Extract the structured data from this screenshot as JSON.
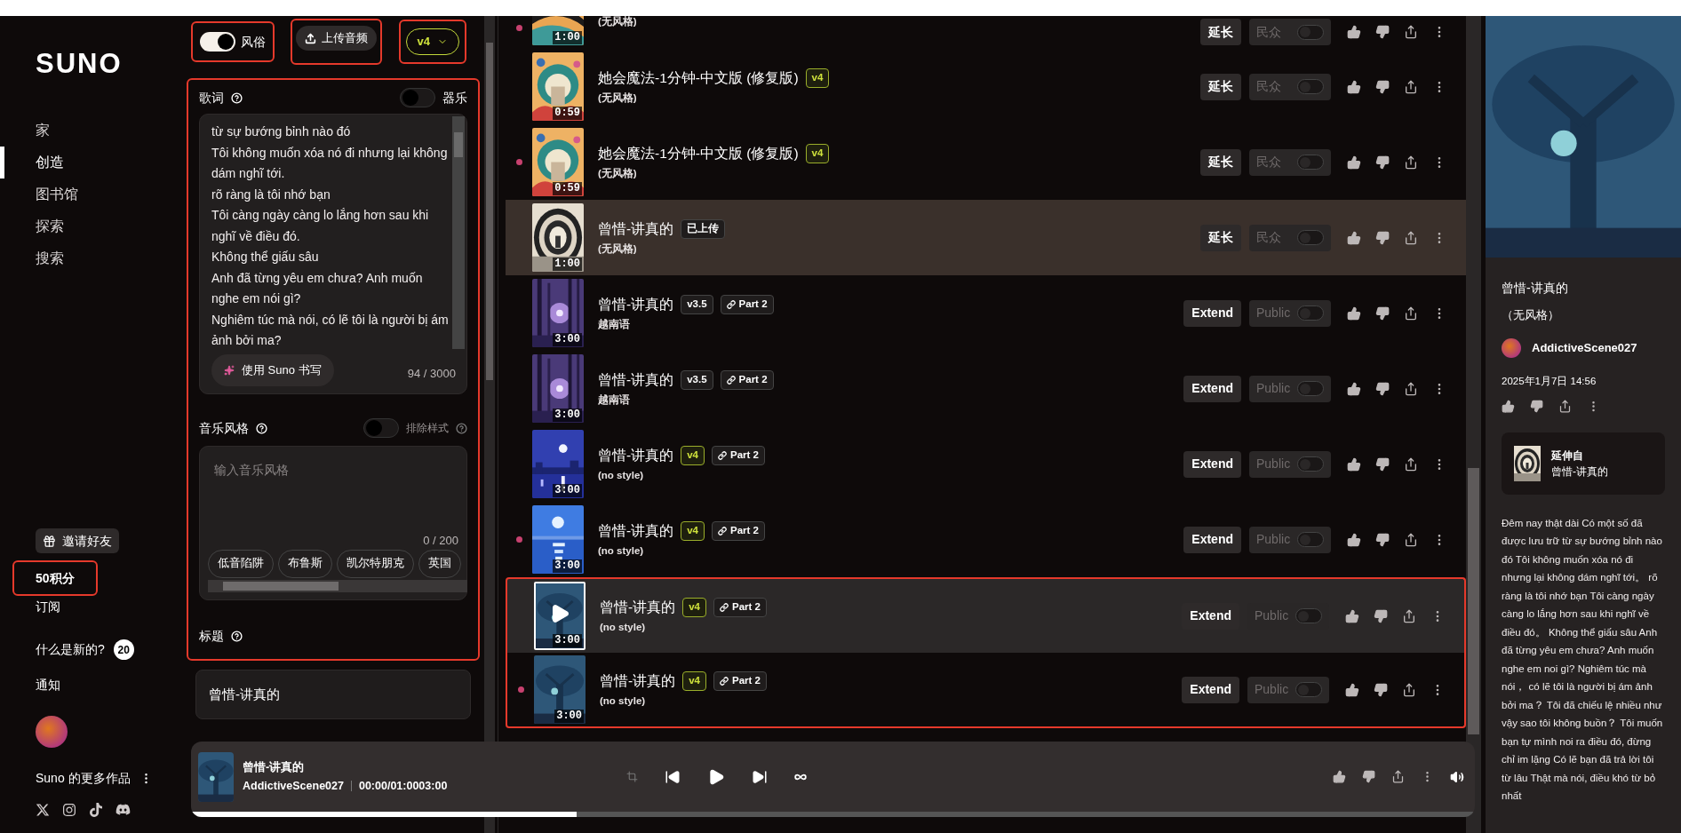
{
  "sidebar": {
    "logo": "SUNO",
    "nav": [
      {
        "label": "家",
        "selected": false
      },
      {
        "label": "创造",
        "selected": true
      },
      {
        "label": "图书馆",
        "selected": false
      },
      {
        "label": "探索",
        "selected": false
      },
      {
        "label": "搜索",
        "selected": false
      }
    ],
    "invite": "邀请好友",
    "credits": {
      "label": "50积分",
      "framed": true
    },
    "subscribe": "订阅",
    "whats_new": {
      "label": "什么是新的?",
      "count": "20"
    },
    "notifications": "通知",
    "more_from": "Suno 的更多作品"
  },
  "create": {
    "style_toggle": {
      "label": "风俗",
      "on": true,
      "framed": true
    },
    "upload": {
      "label": "上传音频",
      "framed": true
    },
    "version": {
      "label": "v4",
      "framed": true
    },
    "prompt_panel": {
      "framed": true,
      "lyrics": {
        "label": "歌词",
        "instrumental": {
          "label": "器乐",
          "on": false
        },
        "value": "từ sự bướng bỉnh nào đó\nTôi không muốn xóa nó đi nhưng lại không dám nghĩ tới.\nrõ ràng là tôi nhớ bạn\nTôi càng ngày càng lo lắng hơn sau khi nghĩ về điều đó.\nKhông thể giấu sâu\nAnh đã từng yêu em chưa? Anh muốn nghe em nói gì?\nNghiêm túc mà nói, có lẽ tôi là người bị ám ảnh bởi ma?",
        "write_button": "使用 Suno 书写",
        "counter": "94 / 3000"
      },
      "style": {
        "label": "音乐风格",
        "exclude": {
          "label": "排除样式",
          "on": false
        },
        "placeholder": "输入音乐风格",
        "counter": "0 / 200",
        "tags": [
          "低音陷阱",
          "布鲁斯",
          "凯尔特朋克",
          "英国"
        ]
      },
      "title_label": "标题"
    },
    "title_value": "曾惜-讲真的"
  },
  "songs": {
    "rows": [
      {
        "subtitle": "(无风格)",
        "duration": "1:00",
        "extend": "延长",
        "visibility": "民众",
        "public": false,
        "unread": true,
        "selected": false,
        "highlighted": false,
        "framed": false
      },
      {
        "title": "她会魔法-1分钟-中文版 (修复版)",
        "badges": [
          {
            "kind": "version-current",
            "label": "v4"
          }
        ],
        "subtitle": "(无风格)",
        "duration": "0:59",
        "extend": "延长",
        "visibility": "民众",
        "public": false,
        "unread": false,
        "selected": false,
        "highlighted": false,
        "framed": false
      },
      {
        "title": "她会魔法-1分钟-中文版 (修复版)",
        "badges": [
          {
            "kind": "version-current",
            "label": "v4"
          }
        ],
        "subtitle": "(无风格)",
        "duration": "0:59",
        "extend": "延长",
        "visibility": "民众",
        "public": false,
        "unread": true,
        "selected": false,
        "highlighted": false,
        "framed": false
      },
      {
        "title": "曾惜-讲真的",
        "badges": [
          {
            "kind": "uploaded",
            "label": "已上传"
          }
        ],
        "subtitle": "(无风格)",
        "duration": "1:00",
        "extend": "延长",
        "visibility": "民众",
        "public": false,
        "unread": false,
        "selected": false,
        "highlighted": true,
        "framed": false
      },
      {
        "title": "曾惜-讲真的",
        "badges": [
          {
            "kind": "version-legacy",
            "label": "v3.5"
          },
          {
            "kind": "part",
            "label": "Part 2"
          }
        ],
        "subtitle": "越南语",
        "duration": "3:00",
        "extend": "Extend",
        "visibility": "Public",
        "public": false,
        "unread": false,
        "selected": false,
        "highlighted": false,
        "framed": false
      },
      {
        "title": "曾惜-讲真的",
        "badges": [
          {
            "kind": "version-legacy",
            "label": "v3.5"
          },
          {
            "kind": "part",
            "label": "Part 2"
          }
        ],
        "subtitle": "越南语",
        "duration": "3:00",
        "extend": "Extend",
        "visibility": "Public",
        "public": false,
        "unread": false,
        "selected": false,
        "highlighted": false,
        "framed": false
      },
      {
        "title": "曾惜-讲真的",
        "badges": [
          {
            "kind": "version-current",
            "label": "v4"
          },
          {
            "kind": "part",
            "label": "Part 2"
          }
        ],
        "subtitle": "(no style)",
        "duration": "3:00",
        "extend": "Extend",
        "visibility": "Public",
        "public": false,
        "unread": false,
        "selected": false,
        "highlighted": false,
        "framed": false
      },
      {
        "title": "曾惜-讲真的",
        "badges": [
          {
            "kind": "version-current",
            "label": "v4"
          },
          {
            "kind": "part",
            "label": "Part 2"
          }
        ],
        "subtitle": "(no style)",
        "duration": "3:00",
        "extend": "Extend",
        "visibility": "Public",
        "public": false,
        "unread": true,
        "selected": false,
        "highlighted": false,
        "framed": false
      },
      {
        "title": "曾惜-讲真的",
        "badges": [
          {
            "kind": "version-current",
            "label": "v4"
          },
          {
            "kind": "part",
            "label": "Part 2"
          }
        ],
        "subtitle": "(no style)",
        "duration": "3:00",
        "extend": "Extend",
        "visibility": "Public",
        "public": false,
        "unread": false,
        "selected": true,
        "highlighted": false,
        "framed": true
      },
      {
        "title": "曾惜-讲真的",
        "badges": [
          {
            "kind": "version-current",
            "label": "v4"
          },
          {
            "kind": "part",
            "label": "Part 2"
          }
        ],
        "subtitle": "(no style)",
        "duration": "3:00",
        "extend": "Extend",
        "visibility": "Public",
        "public": false,
        "unread": true,
        "selected": false,
        "highlighted": false,
        "framed": true
      }
    ]
  },
  "detail": {
    "title": "曾惜-讲真的",
    "style": "（无风格）",
    "artist": "AddictiveScene027",
    "date": "2025年1月7日 14:56",
    "extended_from": {
      "label": "延伸自",
      "title": "曾惜-讲真的"
    },
    "lyrics": "Đêm nay thật dài Có một số đã được lưu trữ từ sự bướng bỉnh nào đó Tôi không muốn xóa nó đi nhưng lại không dám nghĩ tới。 rõ ràng là tôi nhớ bạn Tôi càng ngày càng lo lắng hơn sau khi nghĩ về điều đó。 Không thể giấu sâu Anh đã từng yêu em chưa? Anh muốn nghe em noi gì? Nghiêm túc mà nói， có lẽ tôi là người bị ám ảnh bởi ma？ Tôi đã chiếu lệ nhiều như vậy sao tôi không buồn？ Tôi muốn bạn tự mình noi ra điều đó, đừng chỉ im lặng Có lẽ bạn đã trả lời tôi từ lâu Thật mà nói, điều khó từ bỏ nhất"
  },
  "player": {
    "title": "曾惜-讲真的",
    "artist": "AddictiveScene027",
    "time": "00:00/01:0003:00",
    "level": 0.3
  }
}
